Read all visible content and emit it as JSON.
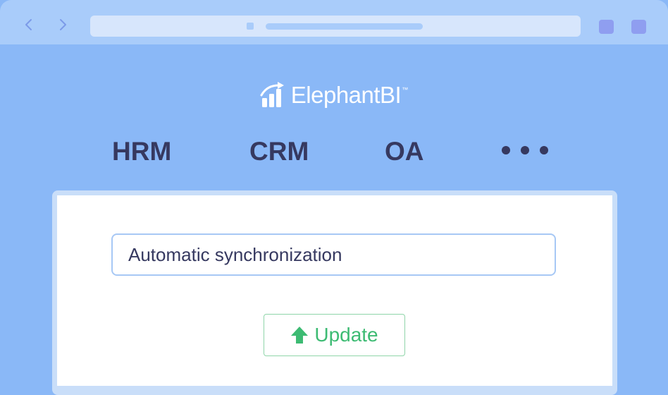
{
  "colors": {
    "page_background": "#8ab8f7",
    "chrome_background": "#a9ccfa",
    "address_bar": "#d7e6fc",
    "window_buttons": "#8f9ef0",
    "nav_text": "#363960",
    "update_green": "#3dbb73"
  },
  "browser": {
    "back_icon": "chevron-left-icon",
    "forward_icon": "chevron-right-icon"
  },
  "logo": {
    "icon": "bar-chart-trend-icon",
    "text": "ElephantBI",
    "trademark": "™"
  },
  "nav": {
    "items": [
      {
        "label": "HRM"
      },
      {
        "label": "CRM"
      },
      {
        "label": "OA"
      }
    ],
    "more_icon": "more-dots-icon"
  },
  "form": {
    "sync_value": "Automatic synchronization",
    "update_icon": "arrow-up-icon",
    "update_label": "Update"
  }
}
